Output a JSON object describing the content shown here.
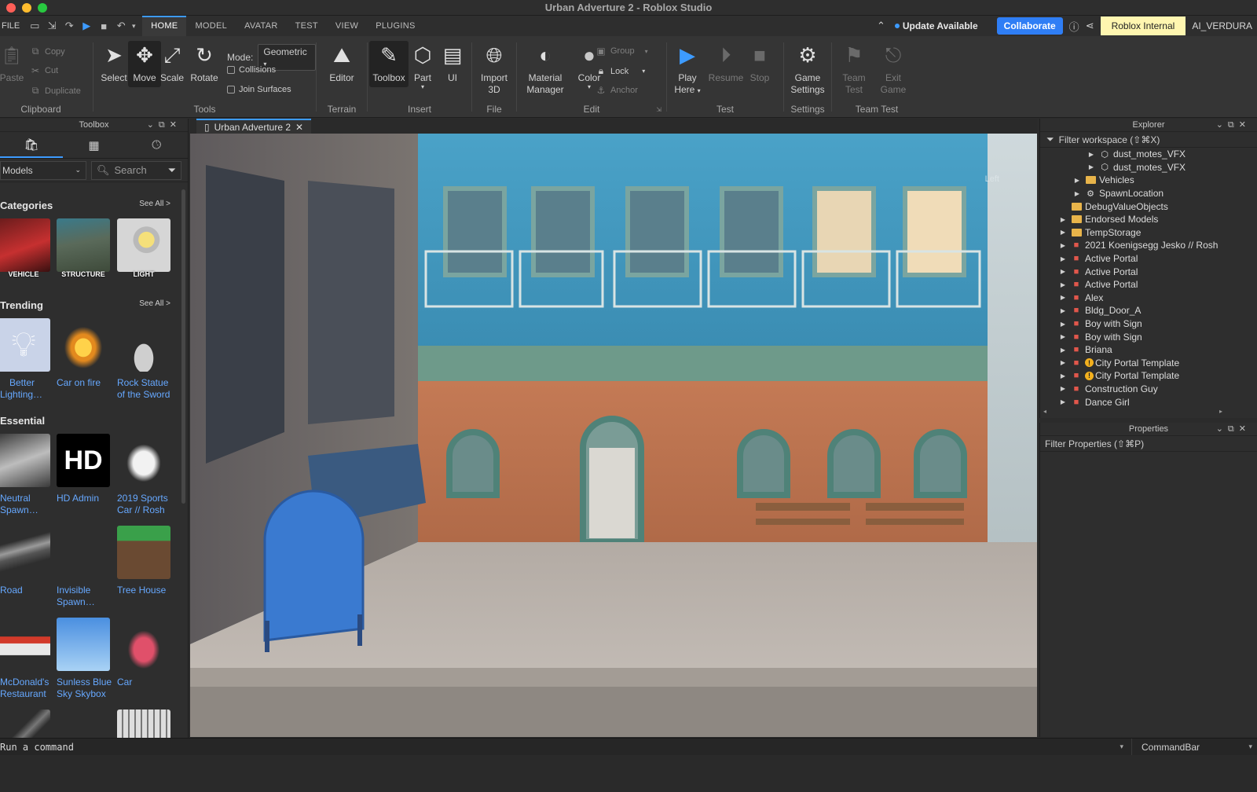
{
  "window": {
    "title": "Urban Adverture 2 - Roblox Studio"
  },
  "menu": {
    "file_label": "FILE",
    "tabs": [
      "HOME",
      "MODEL",
      "AVATAR",
      "TEST",
      "VIEW",
      "PLUGINS"
    ],
    "active_tab": "HOME",
    "update_label": "Update Available",
    "collaborate_label": "Collaborate",
    "internal_label": "Roblox Internal",
    "user_label": "AI_VERDURA"
  },
  "ribbon": {
    "clipboard": {
      "label": "Clipboard",
      "paste": "Paste",
      "copy": "Copy",
      "cut": "Cut",
      "duplicate": "Duplicate"
    },
    "tools": {
      "label": "Tools",
      "select": "Select",
      "move": "Move",
      "scale": "Scale",
      "rotate": "Rotate",
      "mode_label": "Mode:",
      "mode_value": "Geometric",
      "collisions": "Collisions",
      "join_surfaces": "Join Surfaces"
    },
    "terrain": {
      "label": "Terrain",
      "editor": "Editor"
    },
    "insert": {
      "label": "Insert",
      "toolbox": "Toolbox",
      "part": "Part",
      "ui": "UI"
    },
    "file": {
      "label": "File",
      "import": "Import",
      "import2": "3D"
    },
    "edit": {
      "label": "Edit",
      "material": "Material",
      "material2": "Manager",
      "color": "Color",
      "group": "Group",
      "lock": "Lock",
      "anchor": "Anchor"
    },
    "test": {
      "label": "Test",
      "play": "Play",
      "play2": "Here",
      "resume": "Resume",
      "stop": "Stop"
    },
    "settings": {
      "label": "Settings",
      "game": "Game",
      "game2": "Settings"
    },
    "team_test": {
      "label": "Team Test",
      "team": "Team",
      "team2": "Test",
      "exit": "Exit",
      "exit2": "Game"
    }
  },
  "toolbox": {
    "title": "Toolbox",
    "category_select": "Models",
    "search_placeholder": "Search",
    "sections": {
      "categories": {
        "title": "Categories",
        "see_all": "See All >",
        "items": [
          "VEHICLE",
          "STRUCTURE",
          "LIGHT"
        ]
      },
      "trending": {
        "title": "Trending",
        "see_all": "See All >",
        "items": [
          {
            "name1": "Better",
            "name2": "Lighting…"
          },
          {
            "name1": "Car on fire",
            "name2": ""
          },
          {
            "name1": "Rock Statue",
            "name2": "of the Sword"
          }
        ]
      },
      "essential": {
        "title": "Essential",
        "rows": [
          [
            {
              "name1": "Neutral",
              "name2": "Spawn…"
            },
            {
              "name1": "HD Admin",
              "name2": ""
            },
            {
              "name1": "2019 Sports",
              "name2": "Car // Rosh"
            }
          ],
          [
            {
              "name1": "Road",
              "name2": ""
            },
            {
              "name1": "Invisible",
              "name2": "Spawn…"
            },
            {
              "name1": "Tree House",
              "name2": ""
            }
          ],
          [
            {
              "name1": "McDonald's",
              "name2": "Restaurant"
            },
            {
              "name1": "Sunless Blue",
              "name2": "Sky Skybox"
            },
            {
              "name1": "Car",
              "name2": ""
            }
          ]
        ]
      }
    },
    "hd_text": "HD"
  },
  "document": {
    "tab_label": "Urban Adverture 2",
    "view_label": "Left"
  },
  "explorer": {
    "title": "Explorer",
    "filter": "Filter workspace (⇧⌘X)",
    "items": [
      {
        "label": "dust_motes_VFX",
        "indent": 3,
        "icon": "vfx",
        "arrow": true
      },
      {
        "label": "dust_motes_VFX",
        "indent": 3,
        "icon": "vfx",
        "arrow": true
      },
      {
        "label": "Vehicles",
        "indent": 2,
        "icon": "folder",
        "arrow": true
      },
      {
        "label": "SpawnLocation",
        "indent": 2,
        "icon": "gear",
        "arrow": true
      },
      {
        "label": "DebugValueObjects",
        "indent": 1,
        "icon": "folder",
        "arrow": false
      },
      {
        "label": "Endorsed Models",
        "indent": 1,
        "icon": "folder",
        "arrow": true
      },
      {
        "label": "TempStorage",
        "indent": 1,
        "icon": "folder",
        "arrow": true
      },
      {
        "label": "2021 Koenigsegg Jesko // Rosh",
        "indent": 1,
        "icon": "model",
        "arrow": true
      },
      {
        "label": "Active Portal",
        "indent": 1,
        "icon": "model",
        "arrow": true
      },
      {
        "label": "Active Portal",
        "indent": 1,
        "icon": "model",
        "arrow": true
      },
      {
        "label": "Active Portal",
        "indent": 1,
        "icon": "model",
        "arrow": true
      },
      {
        "label": "Alex",
        "indent": 1,
        "icon": "model",
        "arrow": true
      },
      {
        "label": "Bldg_Door_A",
        "indent": 1,
        "icon": "model",
        "arrow": true
      },
      {
        "label": "Boy with Sign",
        "indent": 1,
        "icon": "model",
        "arrow": true
      },
      {
        "label": "Boy with Sign",
        "indent": 1,
        "icon": "model",
        "arrow": true
      },
      {
        "label": "Briana",
        "indent": 1,
        "icon": "model",
        "arrow": true
      },
      {
        "label": "City Portal Template",
        "indent": 1,
        "icon": "model-warn",
        "arrow": true
      },
      {
        "label": "City Portal Template",
        "indent": 1,
        "icon": "model-warn",
        "arrow": true
      },
      {
        "label": "Construction Guy",
        "indent": 1,
        "icon": "model",
        "arrow": true
      },
      {
        "label": "Dance Girl",
        "indent": 1,
        "icon": "model",
        "arrow": true
      }
    ]
  },
  "properties": {
    "title": "Properties",
    "filter": "Filter Properties (⇧⌘P)"
  },
  "command": {
    "placeholder": "Run a command",
    "right_label": "CommandBar"
  }
}
